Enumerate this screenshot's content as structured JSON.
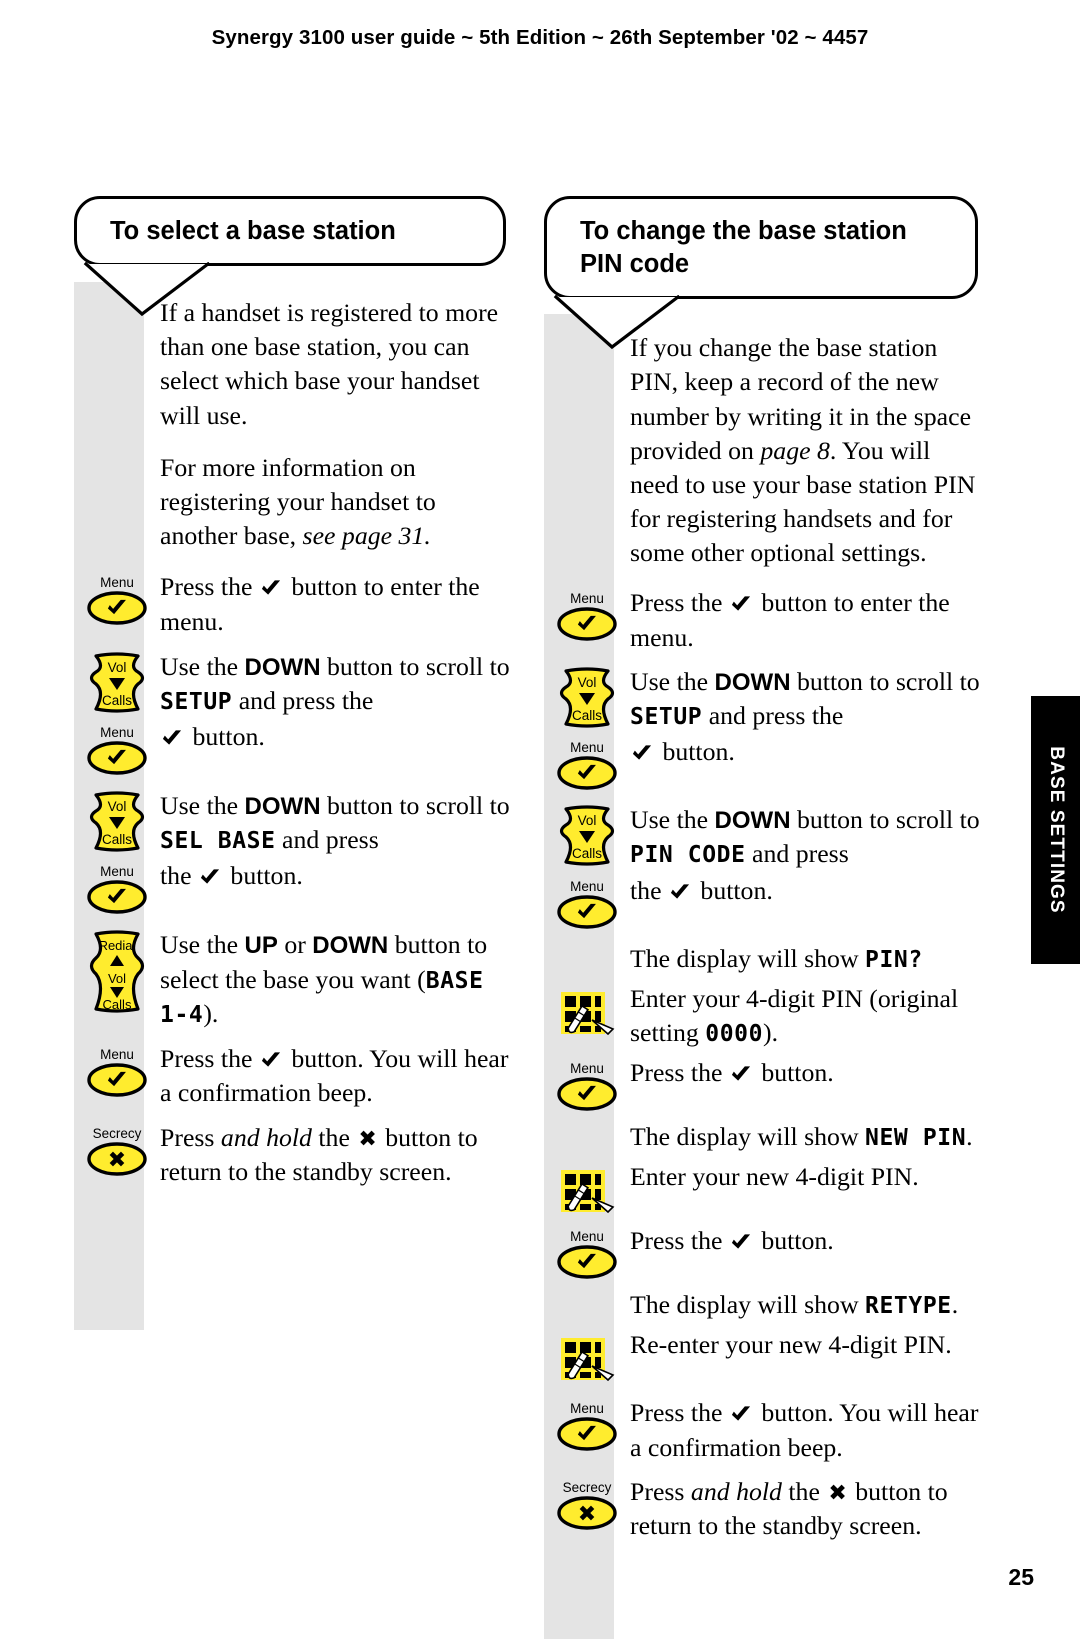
{
  "header": {
    "running_head": "Synergy 3100 user guide ~ 5th Edition ~ 26th September '02 ~ 4457"
  },
  "side_tab": {
    "label": "BASE SETTINGS"
  },
  "folio": {
    "page_number": "25"
  },
  "colors": {
    "key_yellow": "#ffec2e",
    "key_outline": "#000000",
    "strip_grey": "#e4e4e4",
    "tab_black": "#000000"
  },
  "keys": {
    "menu": {
      "caption": "Menu",
      "glyph": "check-mark"
    },
    "vol": {
      "top": "Vol",
      "bottom": "Calls",
      "glyph": "down-triangle"
    },
    "redial": {
      "top": "Redial",
      "middle": "Vol",
      "bottom": "Calls",
      "glyph": "up-down-triangle"
    },
    "secrecy": {
      "caption": "Secrecy",
      "glyph": "cross-mark"
    },
    "keypad": {
      "caption": "keypad",
      "glyph": "keypad-with-hand"
    }
  },
  "left_column": {
    "heading": "To select a base station",
    "intro": [
      "If a handset is registered to more than one base station, you can select which base your handset will use.",
      "For more information on registering your handset to another base, "
    ],
    "intro_italic": "see page 31.",
    "steps": [
      {
        "icon": "menu",
        "parts": [
          {
            "t": "text",
            "v": "Press the "
          },
          {
            "t": "check"
          },
          {
            "t": "text",
            "v": " button to enter the menu."
          }
        ]
      },
      {
        "icon": "vol",
        "parts": [
          {
            "t": "text",
            "v": "Use the "
          },
          {
            "t": "ui",
            "v": "DOWN"
          },
          {
            "t": "text",
            "v": " button to scroll to "
          },
          {
            "t": "lcd",
            "v": "SETUP"
          },
          {
            "t": "text",
            "v": " and press the "
          }
        ]
      },
      {
        "icon": "menu",
        "parts": [
          {
            "t": "check"
          },
          {
            "t": "text",
            "v": " button."
          }
        ]
      },
      {
        "icon": "vol",
        "parts": [
          {
            "t": "text",
            "v": "Use the "
          },
          {
            "t": "ui",
            "v": "DOWN"
          },
          {
            "t": "text",
            "v": " button to scroll to "
          },
          {
            "t": "lcd",
            "v": "SEL BASE"
          },
          {
            "t": "text",
            "v": " and press"
          }
        ]
      },
      {
        "icon": "menu",
        "parts": [
          {
            "t": "text",
            "v": "the "
          },
          {
            "t": "check"
          },
          {
            "t": "text",
            "v": " button."
          }
        ]
      },
      {
        "icon": "redial",
        "parts": [
          {
            "t": "text",
            "v": "Use the "
          },
          {
            "t": "ui",
            "v": "UP"
          },
          {
            "t": "text",
            "v": " or "
          },
          {
            "t": "ui",
            "v": "DOWN"
          },
          {
            "t": "text",
            "v": " button to select the base you want ("
          },
          {
            "t": "lcd",
            "v": "BASE 1-4"
          },
          {
            "t": "text",
            "v": ")."
          }
        ]
      },
      {
        "icon": "menu",
        "parts": [
          {
            "t": "text",
            "v": "Press the "
          },
          {
            "t": "check"
          },
          {
            "t": "text",
            "v": " button. You will hear a confirmation beep."
          }
        ]
      },
      {
        "icon": "secrecy",
        "parts": [
          {
            "t": "text",
            "v": "Press "
          },
          {
            "t": "italic",
            "v": "and hold"
          },
          {
            "t": "text",
            "v": " the "
          },
          {
            "t": "x"
          },
          {
            "t": "text",
            "v": " button to return to the standby screen."
          }
        ]
      }
    ]
  },
  "right_column": {
    "heading_line1": "To change the base station",
    "heading_line2": "PIN code",
    "intro_pre": "If you change the base station PIN, keep a record of the new number by writing it in the space provided on ",
    "intro_italic": "page 8",
    "intro_post": ". You will need to use your base station PIN for registering handsets and for some other optional settings.",
    "steps": [
      {
        "icon": "menu",
        "parts": [
          {
            "t": "text",
            "v": "Press the "
          },
          {
            "t": "check"
          },
          {
            "t": "text",
            "v": " button to enter the menu."
          }
        ]
      },
      {
        "icon": "vol",
        "parts": [
          {
            "t": "text",
            "v": "Use the "
          },
          {
            "t": "ui",
            "v": "DOWN"
          },
          {
            "t": "text",
            "v": " button to scroll to "
          },
          {
            "t": "lcd",
            "v": "SETUP"
          },
          {
            "t": "text",
            "v": " and press the "
          }
        ]
      },
      {
        "icon": "menu",
        "parts": [
          {
            "t": "check"
          },
          {
            "t": "text",
            "v": " button."
          }
        ]
      },
      {
        "icon": "vol",
        "parts": [
          {
            "t": "text",
            "v": "Use the "
          },
          {
            "t": "ui",
            "v": "DOWN"
          },
          {
            "t": "text",
            "v": " button to scroll to "
          },
          {
            "t": "lcd",
            "v": "PIN CODE"
          },
          {
            "t": "text",
            "v": " and press"
          }
        ]
      },
      {
        "icon": "menu",
        "parts": [
          {
            "t": "text",
            "v": "the "
          },
          {
            "t": "check"
          },
          {
            "t": "text",
            "v": " button."
          }
        ]
      },
      {
        "icon": "none",
        "parts": [
          {
            "t": "text",
            "v": "The display will show "
          },
          {
            "t": "lcd",
            "v": "PIN?"
          }
        ]
      },
      {
        "icon": "keypad",
        "parts": [
          {
            "t": "text",
            "v": "Enter your 4-digit PIN (original setting "
          },
          {
            "t": "lcd",
            "v": "0000"
          },
          {
            "t": "text",
            "v": ")."
          }
        ]
      },
      {
        "icon": "menu",
        "parts": [
          {
            "t": "text",
            "v": "Press the "
          },
          {
            "t": "check"
          },
          {
            "t": "text",
            "v": " button."
          }
        ]
      },
      {
        "icon": "none",
        "parts": [
          {
            "t": "text",
            "v": "The display will show "
          },
          {
            "t": "lcd",
            "v": "NEW PIN"
          },
          {
            "t": "text",
            "v": "."
          }
        ]
      },
      {
        "icon": "keypad",
        "parts": [
          {
            "t": "text",
            "v": "Enter your new 4-digit PIN."
          }
        ]
      },
      {
        "icon": "menu",
        "parts": [
          {
            "t": "text",
            "v": "Press the "
          },
          {
            "t": "check"
          },
          {
            "t": "text",
            "v": " button."
          }
        ]
      },
      {
        "icon": "none",
        "parts": [
          {
            "t": "text",
            "v": "The display will show "
          },
          {
            "t": "lcd",
            "v": "RETYPE"
          },
          {
            "t": "text",
            "v": "."
          }
        ]
      },
      {
        "icon": "keypad",
        "parts": [
          {
            "t": "text",
            "v": "Re-enter your new 4-digit PIN."
          }
        ]
      },
      {
        "icon": "menu",
        "parts": [
          {
            "t": "text",
            "v": "Press the "
          },
          {
            "t": "check"
          },
          {
            "t": "text",
            "v": " button. You will hear a confirmation beep."
          }
        ]
      },
      {
        "icon": "secrecy",
        "parts": [
          {
            "t": "text",
            "v": "Press "
          },
          {
            "t": "italic",
            "v": "and hold"
          },
          {
            "t": "text",
            "v": " the "
          },
          {
            "t": "x"
          },
          {
            "t": "text",
            "v": " button to return to the standby screen."
          }
        ]
      }
    ]
  }
}
